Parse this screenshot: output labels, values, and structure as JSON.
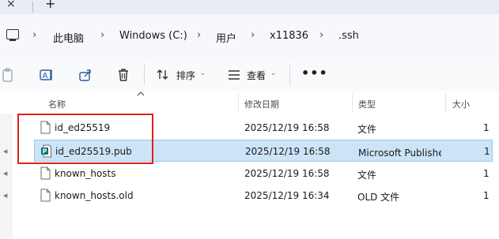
{
  "tabs": {
    "close_glyph": "×",
    "new_glyph": "+"
  },
  "breadcrumb": {
    "items": [
      "此电脑",
      "Windows (C:)",
      "用户",
      "x11836",
      ".ssh"
    ],
    "separator": "›"
  },
  "toolbar": {
    "sort_label": "排序",
    "view_label": "查看",
    "more_glyph": "•••",
    "caret": "⌄"
  },
  "columns": {
    "name": "名称",
    "date": "修改日期",
    "type": "类型",
    "size": "大小"
  },
  "files": [
    {
      "name": "id_ed25519",
      "date": "2025/12/19 16:58",
      "type": "文件",
      "size": "1",
      "icon": "blank-file-icon",
      "selected": false
    },
    {
      "name": "id_ed25519.pub",
      "date": "2025/12/19 16:58",
      "type": "Microsoft Publisher 文档",
      "size": "1",
      "icon": "publisher-file-icon",
      "selected": true
    },
    {
      "name": "known_hosts",
      "date": "2025/12/19 16:58",
      "type": "文件",
      "size": "1",
      "icon": "blank-file-icon",
      "selected": false
    },
    {
      "name": "known_hosts.old",
      "date": "2025/12/19 16:34",
      "type": "OLD 文件",
      "size": "1",
      "icon": "blank-file-icon",
      "selected": false
    }
  ],
  "colors": {
    "selection_bg": "#cce4f7",
    "annotation": "#e0201a",
    "publisher_green": "#077568"
  }
}
